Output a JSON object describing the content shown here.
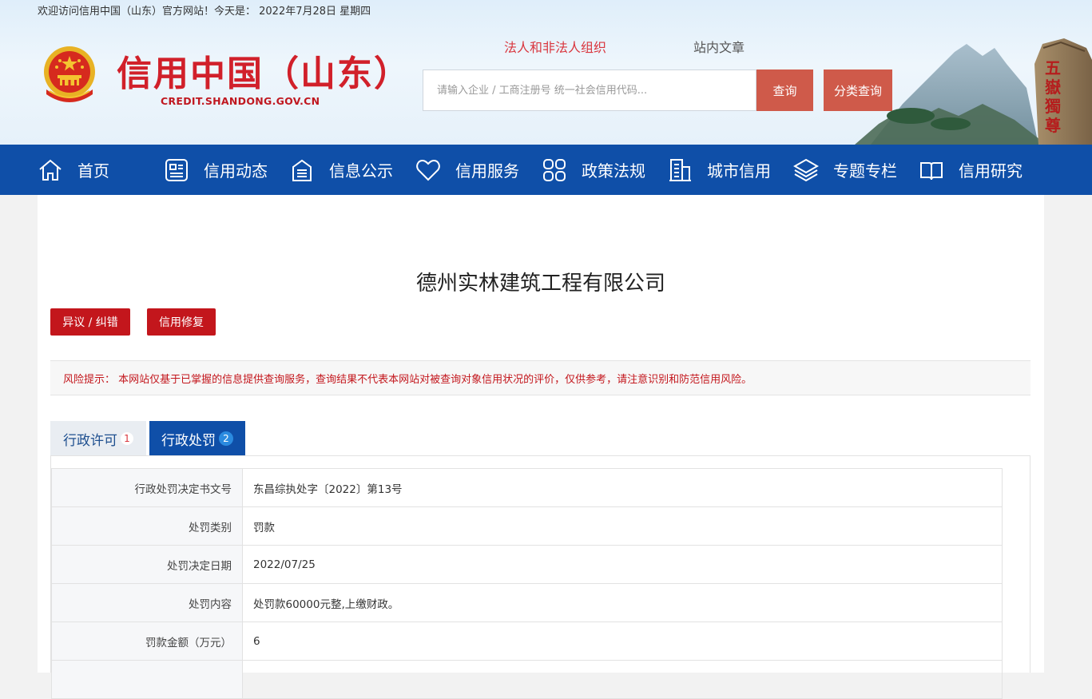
{
  "header": {
    "welcome": "欢迎访问信用中国（山东）官方网站！今天是： 2022年7月28日 星期四",
    "logo_cn": "信用中国（山东）",
    "logo_en": "CREDIT.SHANDONG.GOV.CN"
  },
  "search": {
    "tabs": [
      "法人和非法人组织",
      "站内文章"
    ],
    "placeholder": "请输入企业 / 工商注册号 统一社会信用代码...",
    "query_label": "查询",
    "classify_label": "分类查询"
  },
  "nav": {
    "items": [
      {
        "label": "首页",
        "icon": "home-icon"
      },
      {
        "label": "信用动态",
        "icon": "news-icon"
      },
      {
        "label": "信息公示",
        "icon": "notice-icon"
      },
      {
        "label": "信用服务",
        "icon": "heart-icon"
      },
      {
        "label": "政策法规",
        "icon": "grid-icon"
      },
      {
        "label": "城市信用",
        "icon": "building-icon"
      },
      {
        "label": "专题专栏",
        "icon": "layers-icon"
      },
      {
        "label": "信用研究",
        "icon": "book-icon"
      }
    ]
  },
  "company": {
    "name": "德州实林建筑工程有限公司"
  },
  "actions": {
    "objection": "异议 / 纠错",
    "repair": "信用修复"
  },
  "risk": {
    "text": "风险提示： 本网站仅基于已掌握的信息提供查询服务，查询结果不代表本网站对被查询对象信用状况的评价，仅供参考，请注意识别和防范信用风险。"
  },
  "tabs": [
    {
      "label": "行政许可",
      "count": "1",
      "active": false
    },
    {
      "label": "行政处罚",
      "count": "2",
      "active": true
    }
  ],
  "penalty": {
    "rows": [
      {
        "label": "行政处罚决定书文号",
        "value": "东昌综执处字〔2022〕第13号"
      },
      {
        "label": "处罚类别",
        "value": "罚款"
      },
      {
        "label": "处罚决定日期",
        "value": "2022/07/25"
      },
      {
        "label": "处罚内容",
        "value": "处罚款60000元整,上缴财政。"
      },
      {
        "label": "罚款金额（万元）",
        "value": "6"
      },
      {
        "label": "",
        "value": ""
      }
    ]
  },
  "colors": {
    "nav_bg": "#0f4fa8",
    "brand_red": "#d1202a",
    "button_red": "#c3161c",
    "query_btn": "#cf5a4a"
  }
}
